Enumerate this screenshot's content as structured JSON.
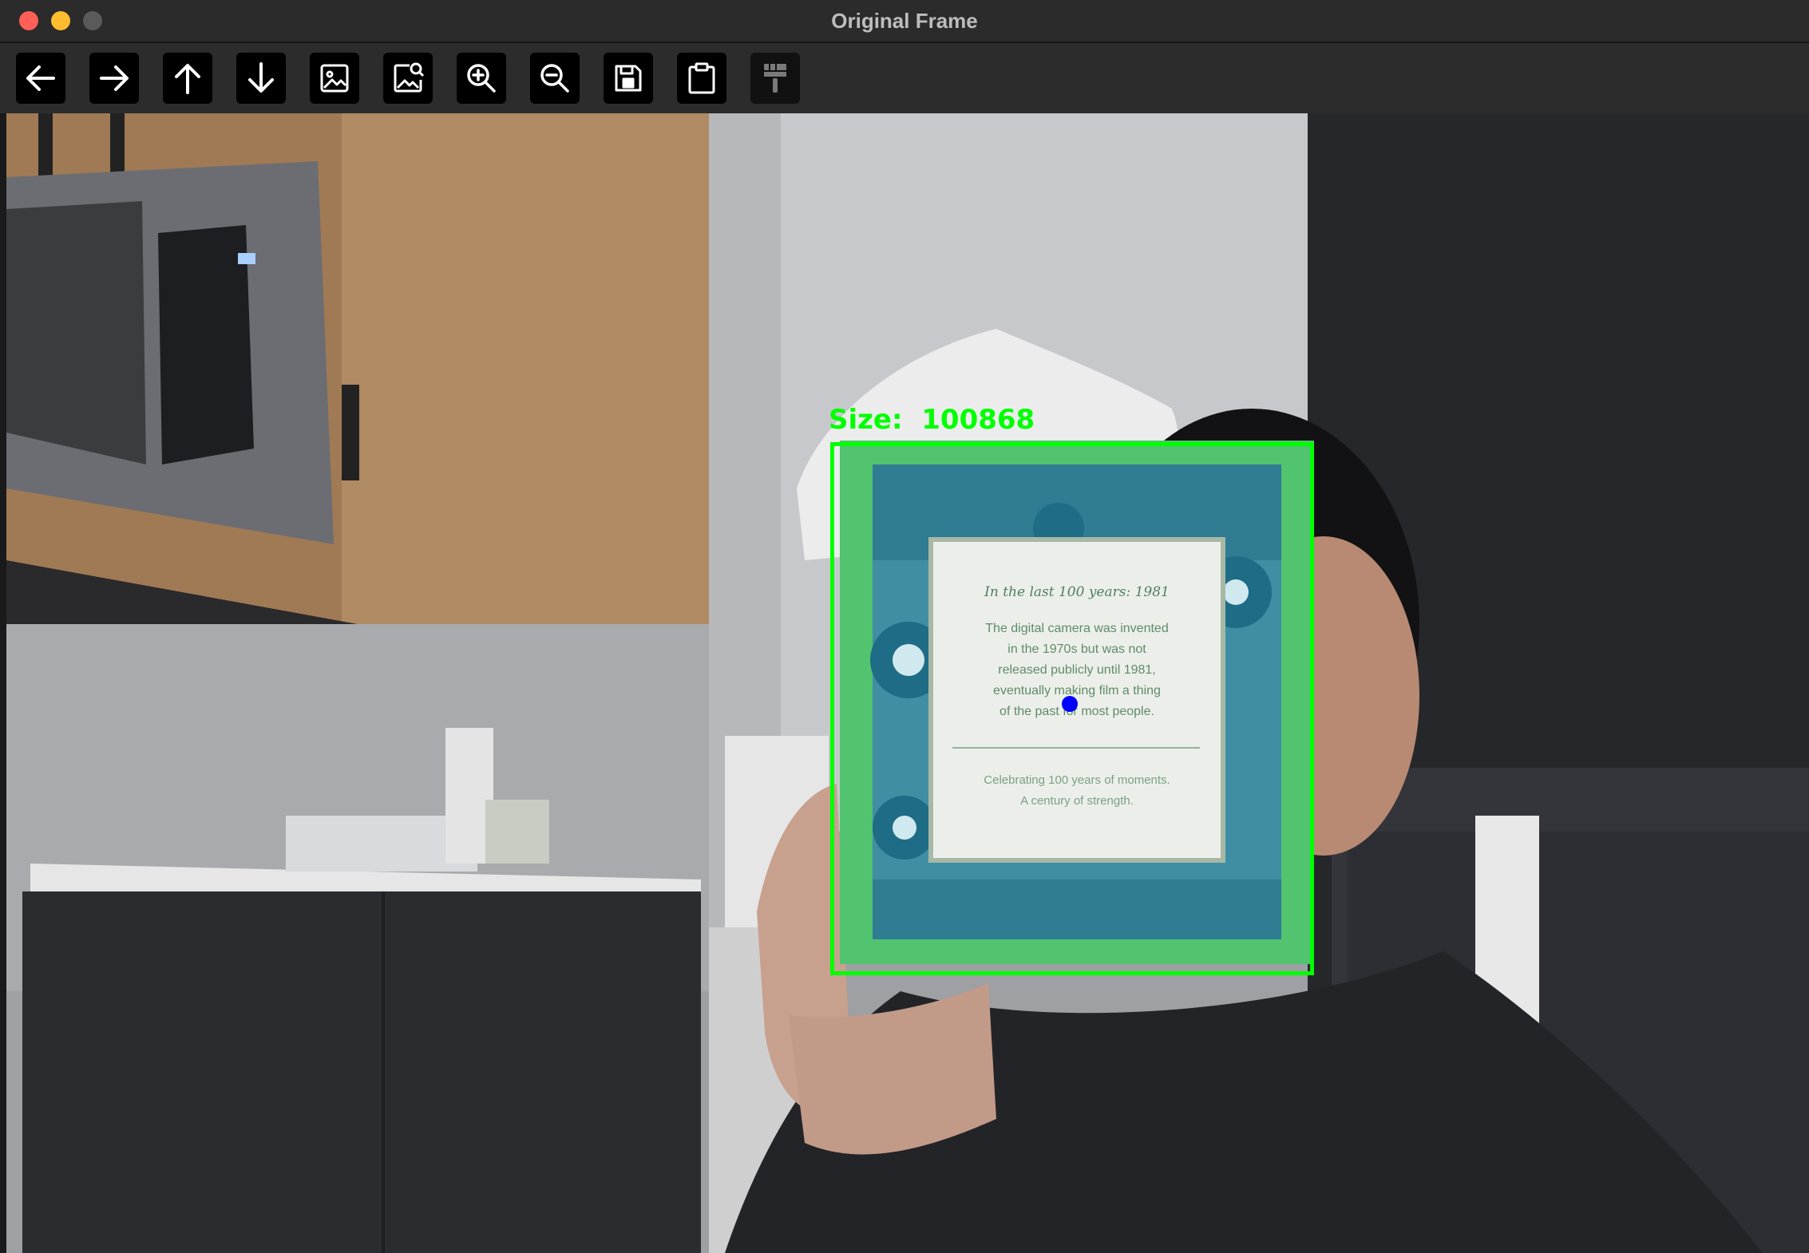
{
  "window": {
    "title": "Original Frame"
  },
  "toolbar": {
    "buttons": [
      {
        "name": "pan-left-button",
        "icon": "arrow-left-icon",
        "enabled": true
      },
      {
        "name": "pan-right-button",
        "icon": "arrow-right-icon",
        "enabled": true
      },
      {
        "name": "pan-up-button",
        "icon": "arrow-up-icon",
        "enabled": true
      },
      {
        "name": "pan-down-button",
        "icon": "arrow-down-icon",
        "enabled": true
      },
      {
        "name": "zoom-fit-button",
        "icon": "image-icon",
        "enabled": true
      },
      {
        "name": "zoom-original-button",
        "icon": "image-search-icon",
        "enabled": true
      },
      {
        "name": "zoom-in-button",
        "icon": "zoom-in-icon",
        "enabled": true
      },
      {
        "name": "zoom-out-button",
        "icon": "zoom-out-icon",
        "enabled": true
      },
      {
        "name": "save-button",
        "icon": "save-icon",
        "enabled": true
      },
      {
        "name": "copy-to-clipboard-button",
        "icon": "clipboard-icon",
        "enabled": true
      },
      {
        "name": "properties-button",
        "icon": "paintbrush-icon",
        "enabled": false
      }
    ]
  },
  "overlay": {
    "label": "Size:  100868",
    "box_color": "#00ff00",
    "centroid_color": "#0000ff"
  },
  "photo": {
    "card_title": "In the last 100 years: 1981",
    "card_body": [
      "The digital camera was invented",
      "in the 1970s but was not",
      "released publicly until 1981,",
      "eventually making film a thing",
      "of the past for most people."
    ],
    "card_footer": [
      "Celebrating 100 years of moments.",
      "A century of strength."
    ]
  }
}
